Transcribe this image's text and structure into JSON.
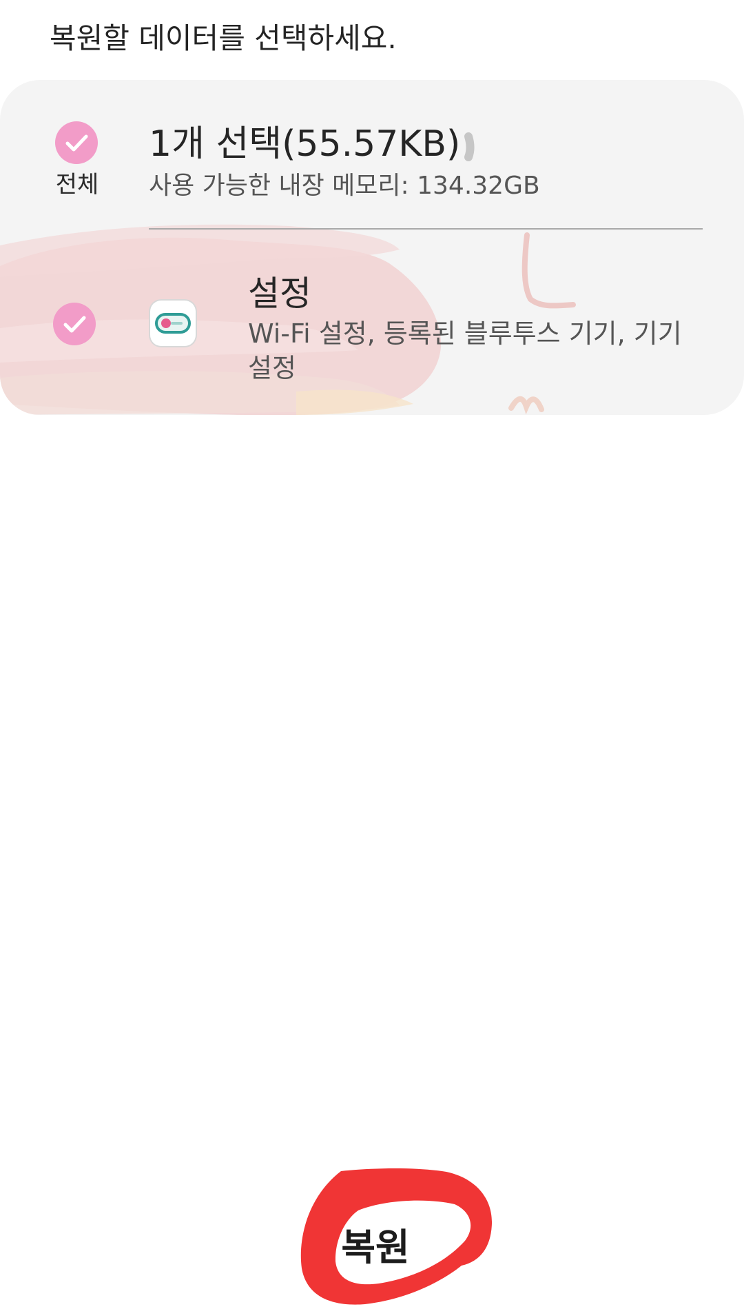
{
  "instruction": "복원할 데이터를 선택하세요.",
  "summary": {
    "select_all_label": "전체",
    "title": "1개 선택(55.57KB)",
    "storage_text": "사용 가능한 내장 메모리: 134.32GB"
  },
  "item": {
    "title": "설정",
    "description": "Wi-Fi 설정, 등록된 블루투스 기기, 기기 설정",
    "icon": "toggle-switch-icon"
  },
  "footer": {
    "restore_label": "복원"
  },
  "colors": {
    "check": "#f29cc8",
    "card": "#f4f4f4",
    "annotation": "#f03535"
  }
}
